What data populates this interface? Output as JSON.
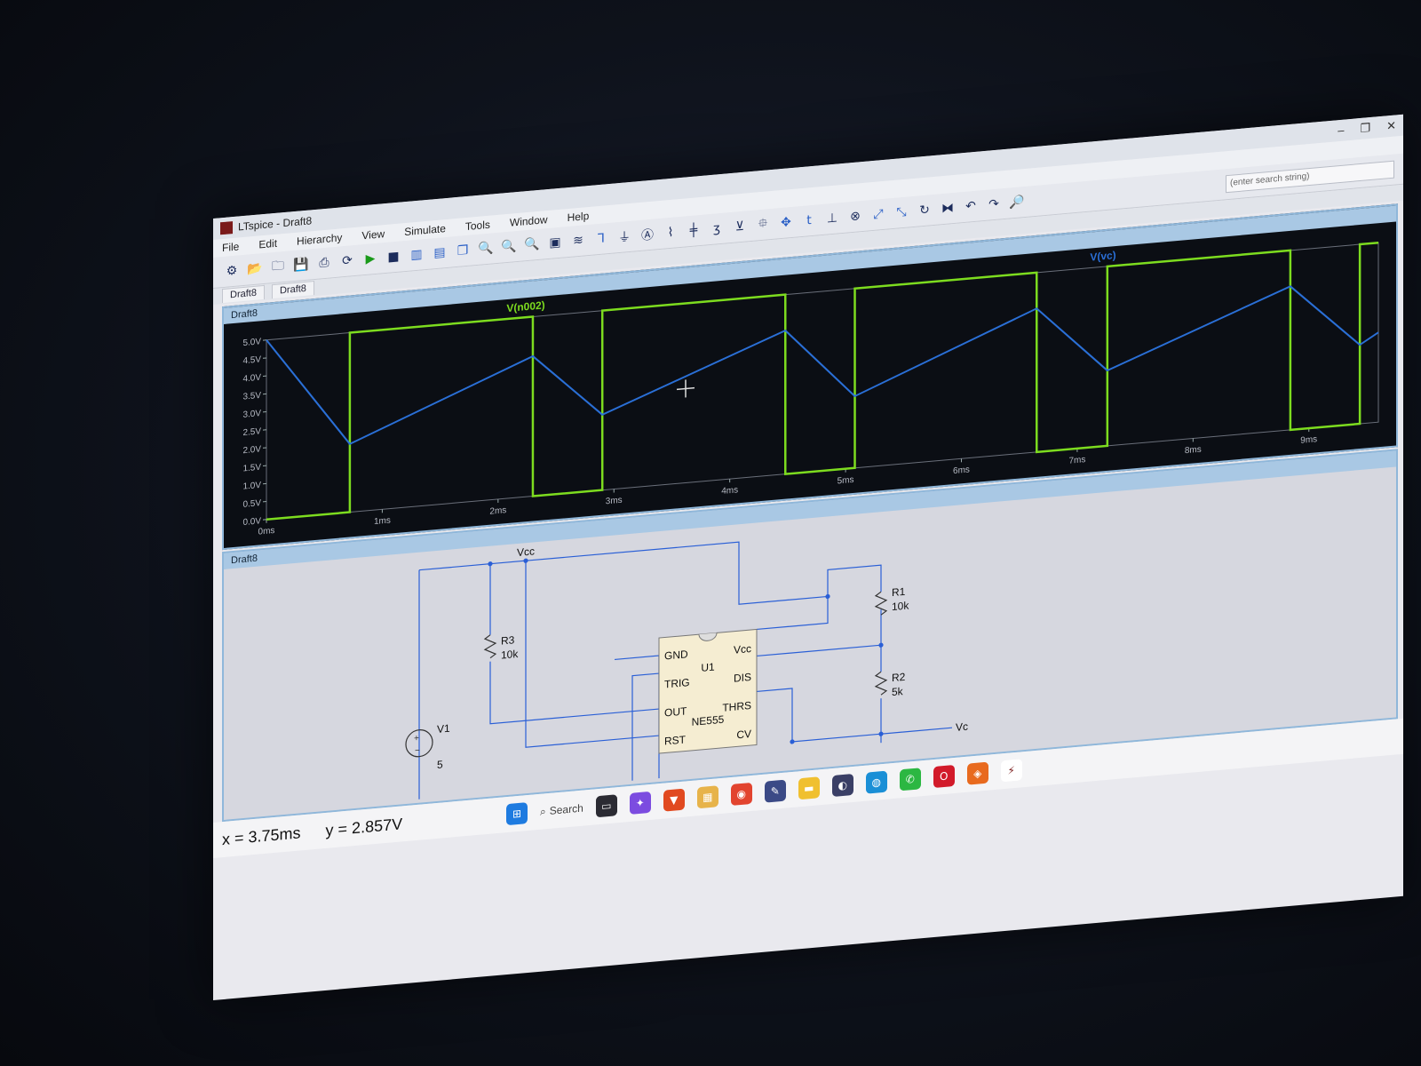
{
  "window": {
    "title": "LTspice - Draft8",
    "controls": [
      "–",
      "❐",
      "✕"
    ]
  },
  "menu": [
    "File",
    "Edit",
    "Hierarchy",
    "View",
    "Simulate",
    "Tools",
    "Window",
    "Help"
  ],
  "toolbar_icons": [
    "settings-icon",
    "open-icon",
    "open-folder-icon",
    "save-icon",
    "print-icon",
    "sync-icon",
    "run-icon",
    "stop-icon",
    "tile-vertical-icon",
    "tile-horizontal-icon",
    "cascade-icon",
    "zoom-in-icon",
    "zoom-out-icon",
    "zoom-fit-icon",
    "zoom-area-icon",
    "autorange-icon",
    "wire-icon",
    "ground-icon",
    "label-icon",
    "resistor-icon",
    "capacitor-icon",
    "inductor-icon",
    "diode-icon",
    "component-icon",
    "move-icon",
    "text-icon",
    "spice-directive-icon",
    "delete-icon",
    "duplicate-icon",
    "drag-icon",
    "rotate-icon",
    "mirror-icon",
    "undo-icon",
    "redo-icon",
    "find-icon"
  ],
  "search": {
    "placeholder": "(enter search string)"
  },
  "tabs": [
    "Draft8",
    "Draft8"
  ],
  "plot": {
    "pane_title": "Draft8",
    "traces": [
      {
        "name": "V(n002)",
        "color": "#7ddc1f"
      },
      {
        "name": "V(vc)",
        "color": "#2a6fd6"
      }
    ]
  },
  "chart_data": {
    "type": "line",
    "xlabel": "",
    "ylabel": "",
    "xlim": [
      0,
      9.6
    ],
    "ylim": [
      0,
      5
    ],
    "x_ticks": [
      "0ms",
      "1ms",
      "2ms",
      "3ms",
      "4ms",
      "5ms",
      "6ms",
      "7ms",
      "8ms",
      "9ms"
    ],
    "y_ticks": [
      "0.0V",
      "0.5V",
      "1.0V",
      "1.5V",
      "2.0V",
      "2.5V",
      "3.0V",
      "3.5V",
      "4.0V",
      "4.5V",
      "5.0V"
    ],
    "series": [
      {
        "name": "V(n002)",
        "x": [
          0,
          0.72,
          0.72,
          2.3,
          2.3,
          2.9,
          2.9,
          4.48,
          4.48,
          5.08,
          5.08,
          6.65,
          6.65,
          7.26,
          7.26,
          8.84,
          8.84,
          9.44,
          9.44,
          9.6
        ],
        "y": [
          0,
          0,
          5,
          5,
          0,
          0,
          5,
          5,
          0,
          0,
          5,
          5,
          0,
          0,
          5,
          5,
          0,
          0,
          5,
          5
        ]
      },
      {
        "name": "V(vc)",
        "x": [
          0,
          0.72,
          2.3,
          2.9,
          4.48,
          5.08,
          6.65,
          7.26,
          8.84,
          9.44,
          9.6
        ],
        "y": [
          5.0,
          1.9,
          3.9,
          2.1,
          4.0,
          2.0,
          4.0,
          2.1,
          4.0,
          2.2,
          2.5
        ]
      }
    ]
  },
  "schematic": {
    "pane_title": "Draft8",
    "ic": {
      "ref": "U1",
      "part": "NE555",
      "pins_left": [
        "GND",
        "TRIG",
        "OUT",
        "RST"
      ],
      "pins_right": [
        "Vcc",
        "DIS",
        "THRS",
        "CV"
      ]
    },
    "components": [
      {
        "ref": "R3",
        "value": "10k"
      },
      {
        "ref": "R1",
        "value": "10k"
      },
      {
        "ref": "R2",
        "value": "5k"
      },
      {
        "ref": "V1",
        "value": "5"
      }
    ],
    "net_labels": [
      "Vcc",
      "Vc"
    ]
  },
  "status": {
    "x_readout": "x = 3.75ms",
    "y_readout": "y = 2.857V"
  },
  "taskbar": {
    "search_label": "Search",
    "apps": [
      "windows-start-icon",
      "search-icon",
      "terminal-icon",
      "copilot-icon",
      "brave-icon",
      "files-icon",
      "chrome-icon",
      "notepad-icon",
      "folder-icon",
      "media-icon",
      "edge-icon",
      "whatsapp-icon",
      "opera-icon",
      "firefox-icon",
      "ltspice-icon"
    ]
  }
}
